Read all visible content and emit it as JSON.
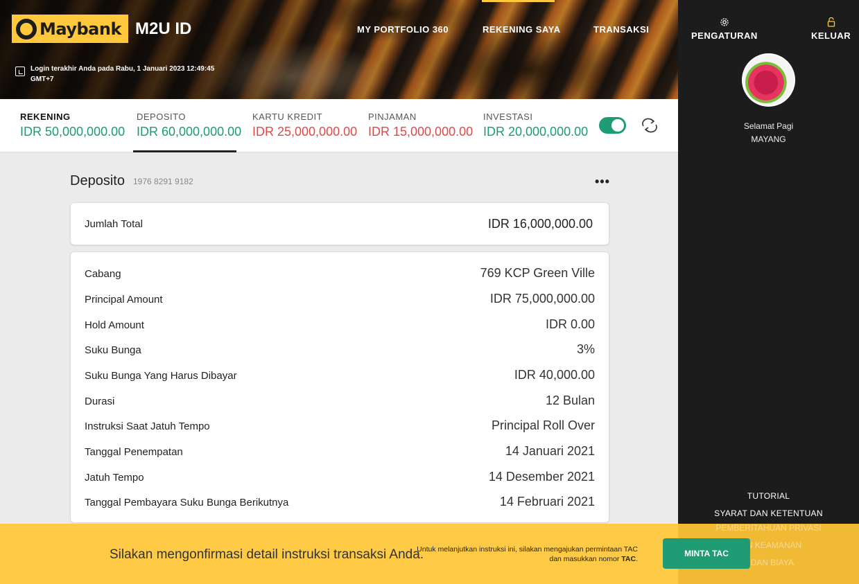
{
  "header": {
    "brand": "Maybank",
    "app_title": "M2U ID",
    "last_login": "Login terakhir Anda pada Rabu, 1 Januari 2023 12:49:45 GMT+7",
    "nav": [
      "MY PORTFOLIO 360",
      "REKENING SAYA",
      "TRANSAKSI"
    ],
    "active_nav": "REKENING SAYA"
  },
  "summary": {
    "items": [
      {
        "label": "REKENING",
        "value": "IDR 50,000,000.00",
        "color": "#1a9b74"
      },
      {
        "label": "DEPOSITO",
        "value": "IDR 60,000,000.00",
        "color": "#1a9b74"
      },
      {
        "label": "KARTU KREDIT",
        "value": "IDR 25,000,000.00",
        "color": "#e04848"
      },
      {
        "label": "PINJAMAN",
        "value": "IDR 15,000,000.00",
        "color": "#e04848"
      },
      {
        "label": "INVESTASI",
        "value": "IDR 20,000,000.00",
        "color": "#1a9b74"
      }
    ],
    "selected_tab": "DEPOSITO",
    "toggle_on": true
  },
  "deposit": {
    "title": "Deposito",
    "account_number": "1976 8291 9182",
    "more": "•••",
    "total_label": "Jumlah Total",
    "total_value": "IDR 16,000,000.00",
    "rows": [
      {
        "label": "Cabang",
        "value": "769 KCP Green Ville"
      },
      {
        "label": "Principal Amount",
        "value": "IDR 75,000,000.00"
      },
      {
        "label": "Hold Amount",
        "value": "IDR 0.00"
      },
      {
        "label": "Suku Bunga",
        "value": "3%"
      },
      {
        "label": "Suku Bunga Yang Harus Dibayar",
        "value": "IDR 40,000.00"
      },
      {
        "label": "Durasi",
        "value": "12 Bulan"
      },
      {
        "label": "Instruksi Saat Jatuh Tempo",
        "value": "Principal Roll Over"
      },
      {
        "label": "Tanggal Penempatan",
        "value": "14 Januari 2021"
      },
      {
        "label": "Jatuh Tempo",
        "value": "14 Desember 2021"
      },
      {
        "label": "Tanggal Pembayara Suku Bunga Berikutnya",
        "value": "14 Februari 2021"
      }
    ]
  },
  "sidebar": {
    "settings": "PENGATURAN",
    "logout": "KELUAR",
    "greeting": "Selamat Pagi",
    "user": "MAYANG",
    "links": [
      "TUTORIAL",
      "SYARAT DAN KETENTUAN",
      "PEMBERITAHUAN PRIVASI",
      "KEBIJAKAN KEAMANAN",
      "BIAYA DAN BIAYA"
    ],
    "links_visible": [
      "TUTORIAL",
      "SYARAT DAN KETENTUAN"
    ],
    "links_covered": [
      "PEMBERITAHUAN PRIVASI",
      "AAN KEAMANAN",
      "T DAN BIAYA"
    ]
  },
  "footer": {
    "message": "Silakan mengonfirmasi detail instruksi transaksi Anda.",
    "note_prefix": "Untuk melanjutkan instruksi ini, silakan mengajukan permintaan TAC dan masukkan nomor",
    "note_bold": "TAC",
    "note_suffix": ".",
    "button": "MINTA TAC"
  },
  "colors": {
    "brand_yellow": "#ffc83d",
    "positive": "#1a9b74",
    "negative": "#e04848",
    "button_green": "#1f9c73",
    "sidebar_bg": "#1c1c1c"
  }
}
